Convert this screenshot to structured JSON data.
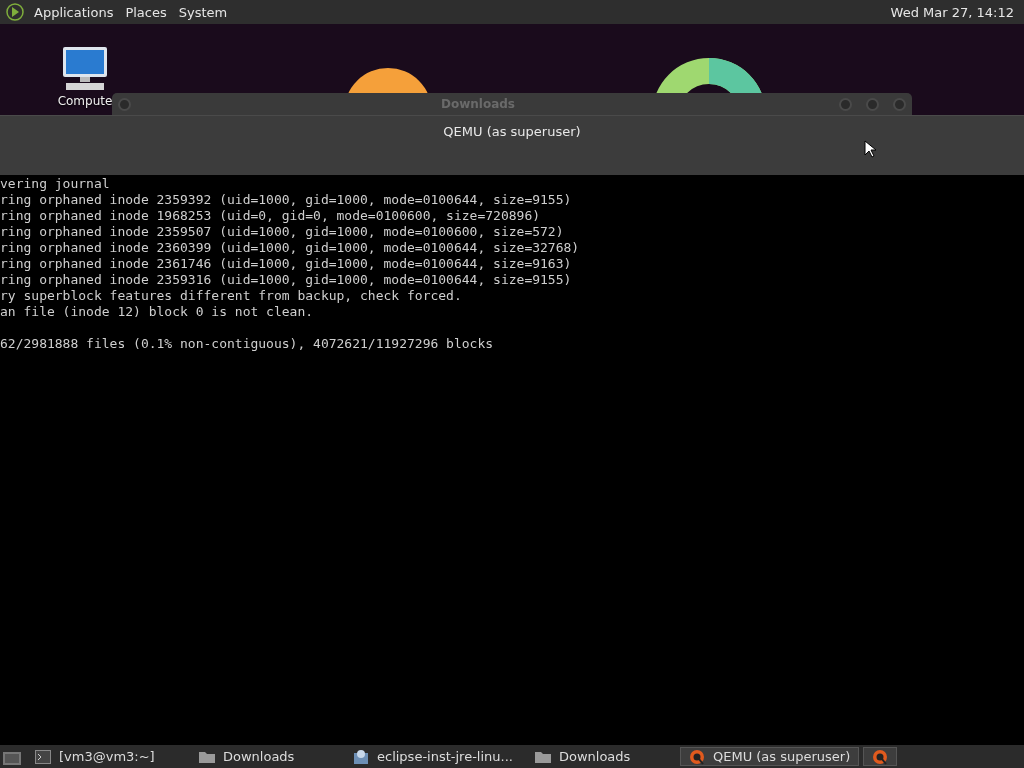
{
  "top_panel": {
    "menus": [
      "Applications",
      "Places",
      "System"
    ],
    "clock": "Wed Mar 27, 14:12"
  },
  "desktop": {
    "icons": [
      {
        "label": "Compute"
      }
    ]
  },
  "background_window": {
    "title": "Downloads"
  },
  "qemu_window": {
    "title": "QEMU (as superuser)",
    "console_lines": [
      "vering journal",
      "ring orphaned inode 2359392 (uid=1000, gid=1000, mode=0100644, size=9155)",
      "ring orphaned inode 1968253 (uid=0, gid=0, mode=0100600, size=720896)",
      "ring orphaned inode 2359507 (uid=1000, gid=1000, mode=0100600, size=572)",
      "ring orphaned inode 2360399 (uid=1000, gid=1000, mode=0100644, size=32768)",
      "ring orphaned inode 2361746 (uid=1000, gid=1000, mode=0100644, size=9163)",
      "ring orphaned inode 2359316 (uid=1000, gid=1000, mode=0100644, size=9155)",
      "ry superblock features different from backup, check forced.",
      "an file (inode 12) block 0 is not clean."
    ],
    "summary_line": "62/2981888 files (0.1% non-contiguous), 4072621/11927296 blocks"
  },
  "taskbar": {
    "items": [
      {
        "kind": "terminal",
        "label": "[vm3@vm3:~]",
        "selected": false
      },
      {
        "kind": "folder",
        "label": "Downloads",
        "selected": false
      },
      {
        "kind": "installer",
        "label": "eclipse-inst-jre-linu...",
        "selected": false
      },
      {
        "kind": "folder",
        "label": "Downloads",
        "selected": false
      },
      {
        "kind": "qemu",
        "label": "QEMU (as superuser)",
        "selected": true
      },
      {
        "kind": "qemu",
        "selected": true
      }
    ]
  }
}
